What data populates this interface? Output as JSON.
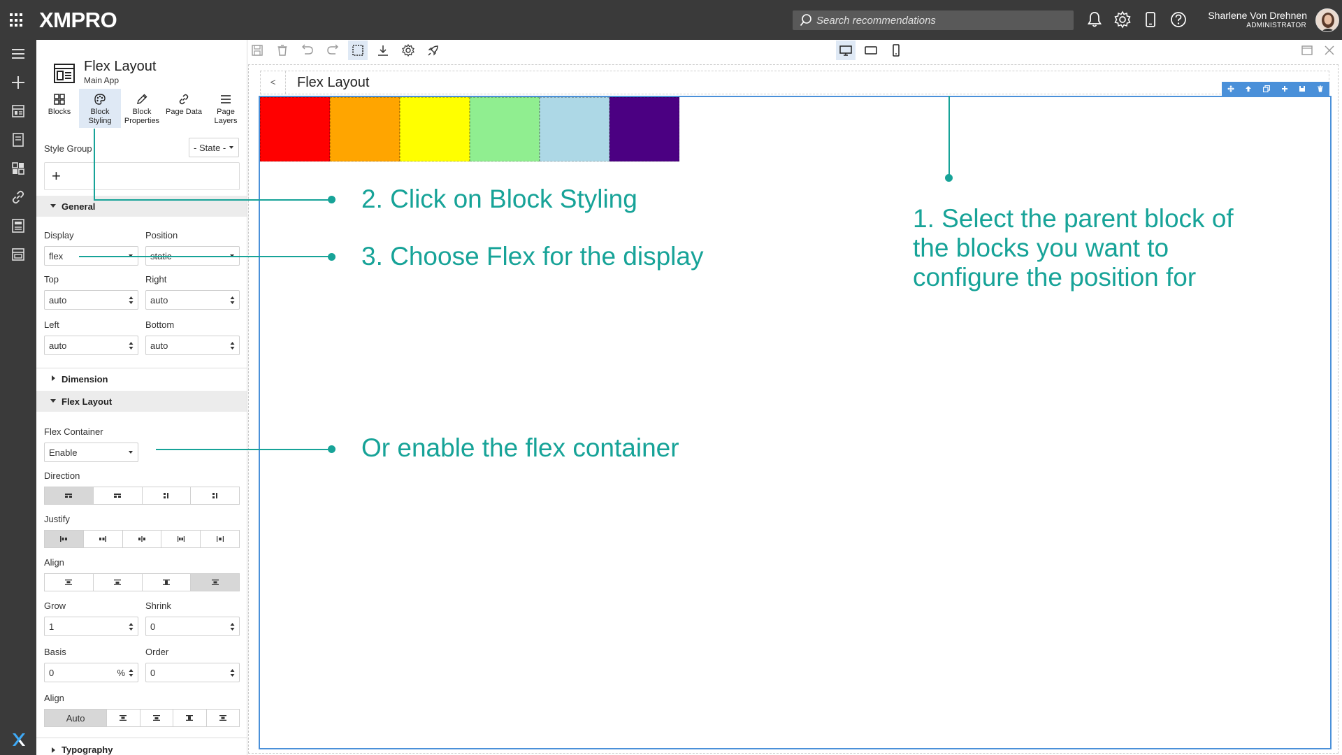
{
  "header": {
    "logo": "XMPRO",
    "search_placeholder": "Search recommendations",
    "user_name": "Sharlene Von Drehnen",
    "user_role": "ADMINISTRATOR",
    "icons": [
      "apps-grid-icon",
      "bell-icon",
      "gear-icon",
      "phone-icon",
      "help-icon"
    ]
  },
  "panel": {
    "title": "Flex Layout",
    "subtitle": "Main App",
    "tabs": [
      {
        "label1": "Blocks",
        "label2": "",
        "icon": "blocks-icon"
      },
      {
        "label1": "Block",
        "label2": "Styling",
        "icon": "palette-icon",
        "active": true
      },
      {
        "label1": "Block",
        "label2": "Properties",
        "icon": "pencil-icon"
      },
      {
        "label1": "Page Data",
        "label2": "",
        "icon": "link-icon"
      },
      {
        "label1": "Page",
        "label2": "Layers",
        "icon": "layers-icon"
      }
    ],
    "style_group_label": "Style Group",
    "state_select": "- State -",
    "add_symbol": "+",
    "general": {
      "title": "General",
      "display_label": "Display",
      "display_value": "flex",
      "position_label": "Position",
      "position_value": "static",
      "top_label": "Top",
      "top_value": "auto",
      "right_label": "Right",
      "right_value": "auto",
      "left_label": "Left",
      "left_value": "auto",
      "bottom_label": "Bottom",
      "bottom_value": "auto"
    },
    "dimension_title": "Dimension",
    "flex": {
      "title": "Flex Layout",
      "container_label": "Flex Container",
      "container_value": "Enable",
      "direction_label": "Direction",
      "justify_label": "Justify",
      "align_label": "Align",
      "grow_label": "Grow",
      "grow_value": "1",
      "shrink_label": "Shrink",
      "shrink_value": "0",
      "basis_label": "Basis",
      "basis_value": "0",
      "basis_unit": "%",
      "order_label": "Order",
      "order_value": "0",
      "self_align_label": "Align",
      "self_align_auto": "Auto"
    },
    "typography_title": "Typography"
  },
  "canvas": {
    "back_label": "<",
    "page_name": "Flex Layout",
    "blocks": [
      {
        "color": "#ff0000"
      },
      {
        "color": "#ffa500"
      },
      {
        "color": "#ffff00"
      },
      {
        "color": "#90ee90"
      },
      {
        "color": "#add8e6"
      },
      {
        "color": "#4b0082"
      }
    ]
  },
  "annotations": {
    "step1": [
      "1. Select the parent block of",
      "the blocks you want to",
      "configure the position for"
    ],
    "step2": "2. Click on Block Styling",
    "step3": "3. Choose Flex for the display",
    "alt": "Or enable the flex container",
    "color": "#17a398"
  },
  "colors": {
    "topbar": "#3a3a3a",
    "accent": "#4a90d9",
    "annotation": "#17a398"
  }
}
